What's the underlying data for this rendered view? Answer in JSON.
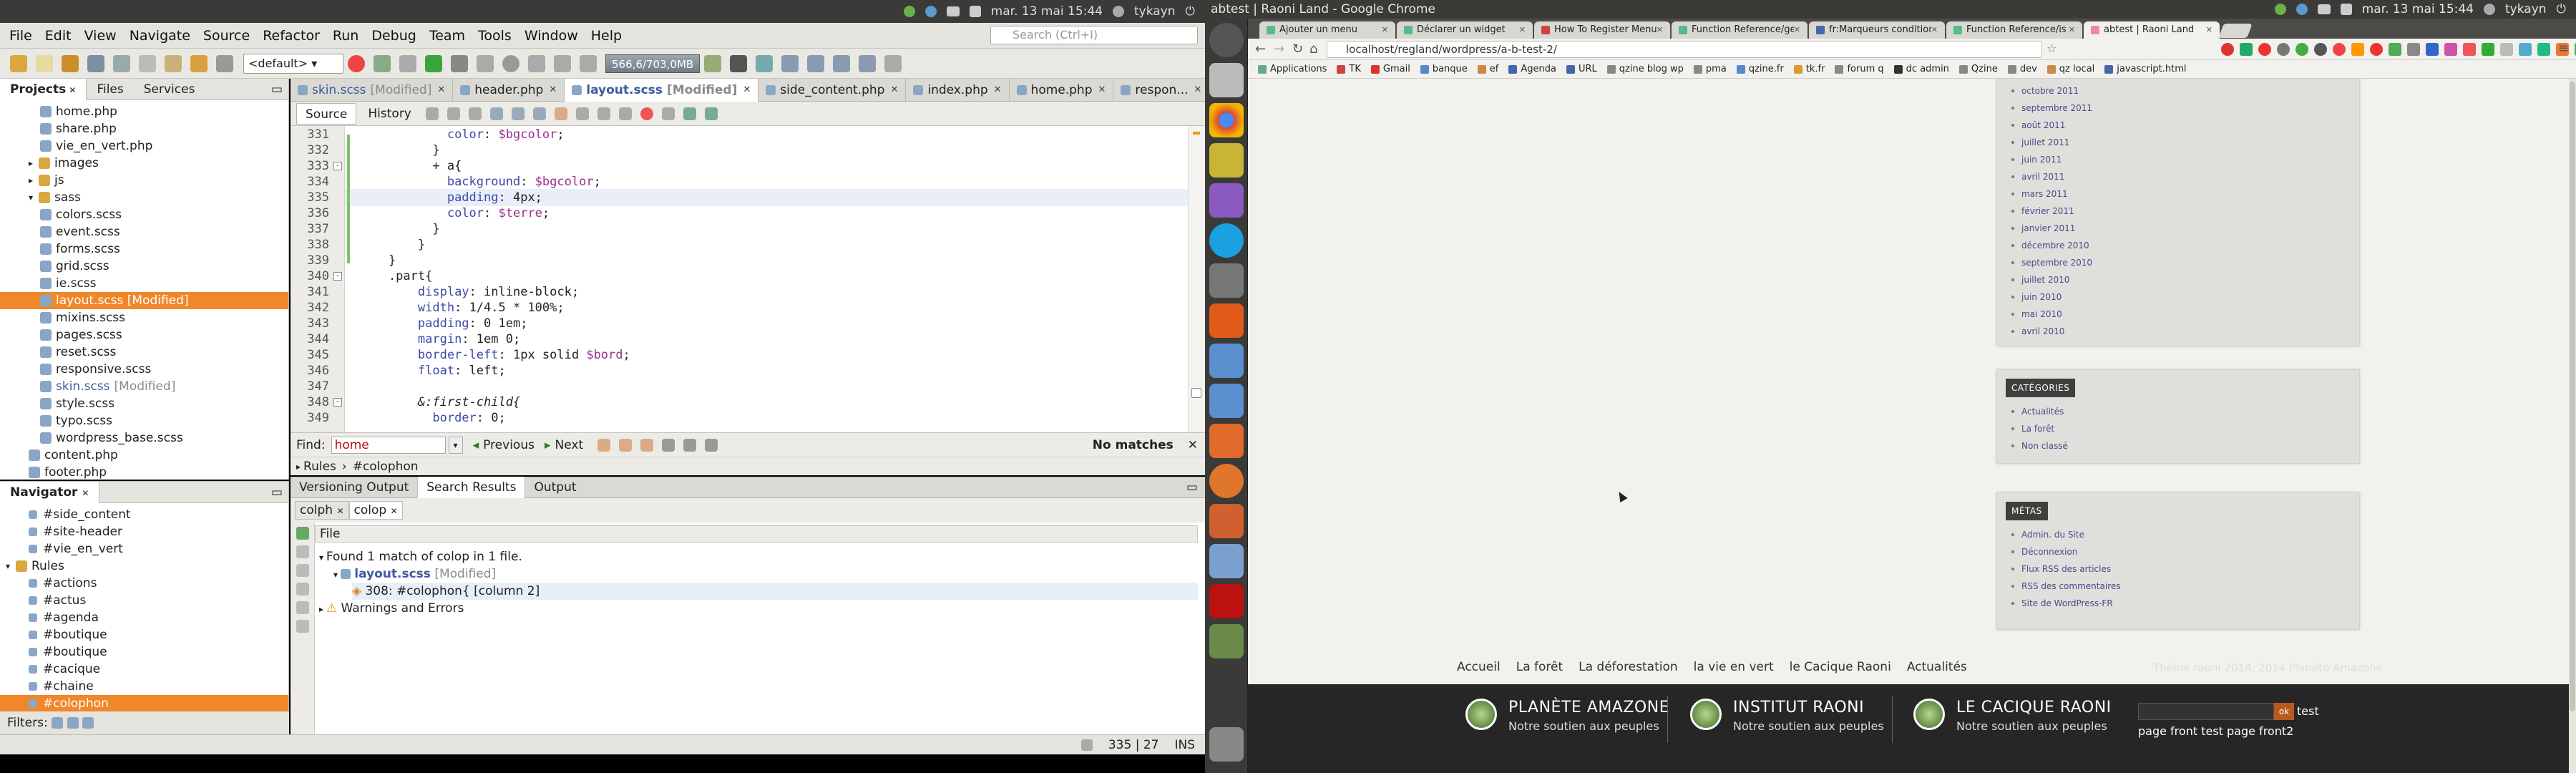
{
  "left_panel": {
    "top_bar": {
      "clock": "mar. 13 mai 15:44",
      "user": "tykayn"
    },
    "menu": [
      "File",
      "Edit",
      "View",
      "Navigate",
      "Source",
      "Refactor",
      "Run",
      "Debug",
      "Team",
      "Tools",
      "Window",
      "Help"
    ],
    "search_placeholder": "Search (Ctrl+I)",
    "toolbar": {
      "config": "<default>",
      "memory": "566,6/703,0MB"
    },
    "projects": {
      "tabs": [
        "Projects",
        "Files",
        "Services"
      ],
      "items": [
        {
          "label": "home.php",
          "indent": 3,
          "kind": "file"
        },
        {
          "label": "share.php",
          "indent": 3,
          "kind": "file"
        },
        {
          "label": "vie_en_vert.php",
          "indent": 3,
          "kind": "file"
        },
        {
          "label": "images",
          "indent": 2,
          "kind": "folder",
          "toggle": "+"
        },
        {
          "label": "js",
          "indent": 2,
          "kind": "folder",
          "toggle": "+"
        },
        {
          "label": "sass",
          "indent": 2,
          "kind": "folder",
          "toggle": "-"
        },
        {
          "label": "colors.scss",
          "indent": 3,
          "kind": "file"
        },
        {
          "label": "event.scss",
          "indent": 3,
          "kind": "file"
        },
        {
          "label": "forms.scss",
          "indent": 3,
          "kind": "file"
        },
        {
          "label": "grid.scss",
          "indent": 3,
          "kind": "file"
        },
        {
          "label": "ie.scss",
          "indent": 3,
          "kind": "file"
        },
        {
          "label": "layout.scss [Modified]",
          "indent": 3,
          "kind": "file",
          "selected": true
        },
        {
          "label": "mixins.scss",
          "indent": 3,
          "kind": "file"
        },
        {
          "label": "pages.scss",
          "indent": 3,
          "kind": "file"
        },
        {
          "label": "reset.scss",
          "indent": 3,
          "kind": "file"
        },
        {
          "label": "responsive.scss",
          "indent": 3,
          "kind": "file"
        },
        {
          "label": "skin.scss",
          "indent": 3,
          "kind": "file",
          "modified": "[Modified]"
        },
        {
          "label": "style.scss",
          "indent": 3,
          "kind": "file"
        },
        {
          "label": "typo.scss",
          "indent": 3,
          "kind": "file"
        },
        {
          "label": "wordpress_base.scss",
          "indent": 3,
          "kind": "file"
        },
        {
          "label": "content.php",
          "indent": 2,
          "kind": "file"
        },
        {
          "label": "footer.php",
          "indent": 2,
          "kind": "file"
        }
      ]
    },
    "navigator": {
      "title": "Navigator",
      "items": [
        {
          "label": "#side_content",
          "indent": 2
        },
        {
          "label": "#site-header",
          "indent": 2
        },
        {
          "label": "#vie_en_vert",
          "indent": 2
        },
        {
          "label": "Rules",
          "indent": 0,
          "toggle": "-",
          "kind": "folder"
        },
        {
          "label": "#actions",
          "indent": 2
        },
        {
          "label": "#actus",
          "indent": 2
        },
        {
          "label": "#agenda",
          "indent": 2
        },
        {
          "label": "#boutique",
          "indent": 2
        },
        {
          "label": "#boutique",
          "indent": 2
        },
        {
          "label": "#cacique",
          "indent": 2
        },
        {
          "label": "#chaine",
          "indent": 2
        },
        {
          "label": "#colophon",
          "indent": 2,
          "selected": true
        }
      ],
      "filters": "Filters:"
    },
    "editor": {
      "tabs": [
        {
          "label": "skin.scss",
          "extra": "[Modified]",
          "active": false
        },
        {
          "label": "header.php",
          "active": false
        },
        {
          "label": "layout.scss",
          "extra": "[Modified]",
          "active": true
        },
        {
          "label": "side_content.php",
          "active": false
        },
        {
          "label": "index.php",
          "active": false
        },
        {
          "label": "home.php",
          "active": false
        },
        {
          "label": "respon...",
          "active": false
        }
      ],
      "source_tab": "Source",
      "history_tab": "History",
      "lines": [
        {
          "n": "331",
          "code": "            color: $bgcolor;"
        },
        {
          "n": "332",
          "code": "          }"
        },
        {
          "n": "333",
          "code": "          + a{"
        },
        {
          "n": "334",
          "code": "            background: $bgcolor;"
        },
        {
          "n": "335",
          "code": "            padding: 4px;"
        },
        {
          "n": "336",
          "code": "            color: $terre;"
        },
        {
          "n": "337",
          "code": "          }"
        },
        {
          "n": "338",
          "code": "        }"
        },
        {
          "n": "339",
          "code": "    }"
        },
        {
          "n": "340",
          "code": "    .part{"
        },
        {
          "n": "341",
          "code": "        display: inline-block;"
        },
        {
          "n": "342",
          "code": "        width: 1/4.5 * 100%;"
        },
        {
          "n": "343",
          "code": "        padding: 0 1em;"
        },
        {
          "n": "344",
          "code": "        margin: 1em 0;"
        },
        {
          "n": "345",
          "code": "        border-left: 1px solid $bord;"
        },
        {
          "n": "346",
          "code": "        float: left;"
        },
        {
          "n": "347",
          "code": ""
        },
        {
          "n": "348",
          "code": "        &:first-child{"
        },
        {
          "n": "349",
          "code": "          border: 0;"
        }
      ],
      "find": {
        "label": "Find:",
        "value": "home",
        "previous": "Previous",
        "next": "Next",
        "status": "No matches"
      },
      "breadcrumb": [
        "Rules",
        "#colophon"
      ]
    },
    "output": {
      "tabs": [
        "Versioning Output",
        "Search Results",
        "Output"
      ],
      "subtabs": [
        "colph",
        "colop"
      ],
      "header": "File",
      "rows": [
        "Found 1 match of colop in 1 file.",
        "layout.scss",
        "308: #colophon{    [column 2]",
        "Warnings and Errors"
      ],
      "row2_extra": "[Modified]"
    },
    "status": {
      "position": "335 | 27",
      "mode": "INS"
    }
  },
  "right_panel": {
    "window_title": "abtest | Raoni Land - Google Chrome",
    "clock": "mar. 13 mai 15:44",
    "user": "tykayn",
    "tabs": [
      "Ajouter un menu",
      "Déclarer un widget",
      "How To Register Menus i",
      "Function Reference/get",
      "fr:Marqueurs condition",
      "Function Reference/is p",
      "abtest | Raoni Land"
    ],
    "url": "localhost/regland/wordpress/a-b-test-2/",
    "bookmarks": [
      "Applications",
      "TK",
      "Gmail",
      "banque",
      "ef",
      "Agenda",
      "URL",
      "qzine blog wp",
      "pma",
      "qzine.fr",
      "tk.fr",
      "forum q",
      "dc admin",
      "Qzine",
      "dev",
      "qz local",
      "javascript.html"
    ],
    "archives": [
      "octobre 2011",
      "septembre 2011",
      "août 2011",
      "juillet 2011",
      "juin 2011",
      "avril 2011",
      "mars 2011",
      "février 2011",
      "janvier 2011",
      "décembre 2010",
      "septembre 2010",
      "juillet 2010",
      "juin 2010",
      "mai 2010",
      "avril 2010"
    ],
    "categories": {
      "title": "CATÉGORIES",
      "items": [
        "Actualités",
        "La forêt",
        "Non classé"
      ]
    },
    "metas": {
      "title": "MÉTAS",
      "items": [
        "Admin. du Site",
        "Déconnexion",
        "Flux RSS des articles",
        "RSS des commentaires",
        "Site de WordPress-FR"
      ]
    },
    "footer_nav": [
      "Accueil",
      "La forêt",
      "La déforestation",
      "la vie en vert",
      "le Cacique Raoni",
      "Actualités"
    ],
    "footer_copy": "Thème raoni 2014, 2014 Planète Amazone",
    "footer_blocks": [
      {
        "title": "PLANÈTE AMAZONE",
        "sub": "Notre soutien aux peuples"
      },
      {
        "title": "INSTITUT RAONI",
        "sub": "Notre soutien aux peuples"
      },
      {
        "title": "LE CACIQUE RAONI",
        "sub": "Notre soutien aux peuples"
      }
    ],
    "footer_search_ok": "ok",
    "footer_test": "test",
    "footer_link": "page front test page front2"
  }
}
